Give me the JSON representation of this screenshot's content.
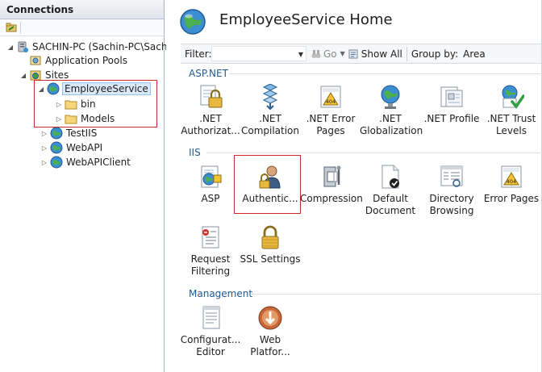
{
  "connections": {
    "title": "Connections",
    "tree": [
      {
        "label": "SACHIN-PC (Sachin-PC\\Sachin)",
        "icon": "server-icon"
      },
      {
        "label": "Application Pools",
        "icon": "app-pool-icon"
      },
      {
        "label": "Sites",
        "icon": "sites-icon"
      },
      {
        "label": "EmployeeService",
        "icon": "globe-icon",
        "selected": true
      },
      {
        "label": "bin",
        "icon": "folder-icon"
      },
      {
        "label": "Models",
        "icon": "folder-icon"
      },
      {
        "label": "TestIIS",
        "icon": "globe-icon"
      },
      {
        "label": "WebAPI",
        "icon": "globe-icon"
      },
      {
        "label": "WebAPIClient",
        "icon": "globe-icon"
      }
    ]
  },
  "main": {
    "title": "EmployeeService Home",
    "filter": {
      "label": "Filter:",
      "value": "",
      "go_label": "Go",
      "show_all_label": "Show All",
      "group_by_label": "Group by:",
      "group_by_value": "Area"
    },
    "sections": [
      {
        "name": "ASP.NET",
        "features": [
          {
            "label": ".NET Authorizat...",
            "icon": "lock-icon"
          },
          {
            "label": ".NET Compilation",
            "icon": "compile-icon"
          },
          {
            "label": ".NET Error Pages",
            "icon": "error-404-icon"
          },
          {
            "label": ".NET Globalization",
            "icon": "globe-icon"
          },
          {
            "label": ".NET Profile",
            "icon": "profile-icon"
          },
          {
            "label": ".NET Trust Levels",
            "icon": "trust-check-icon"
          }
        ]
      },
      {
        "name": "IIS",
        "features": [
          {
            "label": "ASP",
            "icon": "asp-icon"
          },
          {
            "label": "Authentic...",
            "icon": "user-lock-icon"
          },
          {
            "label": "Compression",
            "icon": "clamp-icon"
          },
          {
            "label": "Default Document",
            "icon": "document-check-icon"
          },
          {
            "label": "Directory Browsing",
            "icon": "directory-icon"
          },
          {
            "label": "Error Pages",
            "icon": "error-404-icon"
          },
          {
            "label": "Request Filtering",
            "icon": "filter-list-icon"
          },
          {
            "label": "SSL Settings",
            "icon": "padlock-icon"
          }
        ]
      },
      {
        "name": "Management",
        "features": [
          {
            "label": "Configurat... Editor",
            "icon": "config-editor-icon"
          },
          {
            "label": "Web Platfor...",
            "icon": "web-platform-icon"
          }
        ]
      }
    ]
  },
  "colors": {
    "section_heading": "#1f5a96",
    "highlight_box": "#cc2a2a",
    "selection": "#d9e9f9"
  }
}
